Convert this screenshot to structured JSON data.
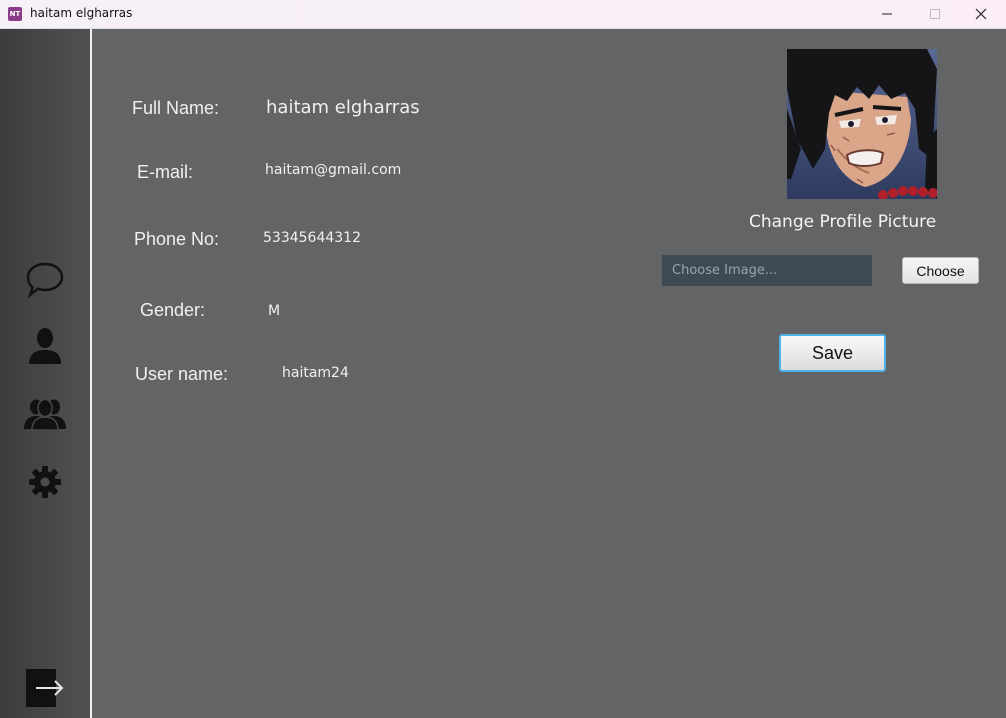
{
  "window": {
    "title": "haitam elgharras",
    "icon_text": "NT",
    "controls": [
      "minimize-icon",
      "maximize-icon",
      "close-icon"
    ]
  },
  "sidebar": {
    "items": [
      {
        "icon": "chat-bubble-icon"
      },
      {
        "icon": "user-icon"
      },
      {
        "icon": "users-group-icon"
      },
      {
        "icon": "settings-gear-icon"
      },
      {
        "icon": "logout-icon"
      }
    ]
  },
  "profile": {
    "full_name_label": "Full Name:",
    "full_name_value": "haitam elgharras",
    "email_label": "E-mail:",
    "email_value": "haitam@gmail.com",
    "phone_label": "Phone No:",
    "phone_value": "53345644312",
    "gender_label": "Gender:",
    "gender_value": "M",
    "username_label": "User name:",
    "username_value": "haitam24"
  },
  "picture": {
    "change_label": "Change Profile Picture",
    "input_placeholder": "Choose Image...",
    "choose_button": "Choose",
    "save_button": "Save"
  },
  "colors": {
    "background": "#636466",
    "sidebar": "#46474a",
    "focus_border": "#4fb3e6",
    "input_bg": "#3d4a53"
  }
}
